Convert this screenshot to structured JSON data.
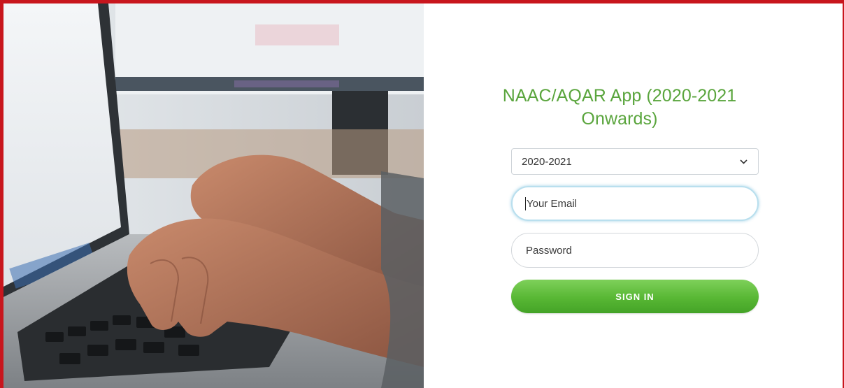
{
  "login": {
    "title": "NAAC/AQAR App (2020-2021 Onwards)",
    "year_select": {
      "selected": "2020-2021",
      "options": [
        "2020-2021"
      ]
    },
    "email_placeholder": "Your Email",
    "password_placeholder": "Password",
    "signin_label": "SIGN IN"
  },
  "hero": {
    "icon": "photo-laptop-typing-hands"
  },
  "colors": {
    "frame_border": "#c8161d",
    "title_green": "#5aa53d",
    "button_green": "#58b734",
    "focus_ring": "#b9dfee"
  }
}
